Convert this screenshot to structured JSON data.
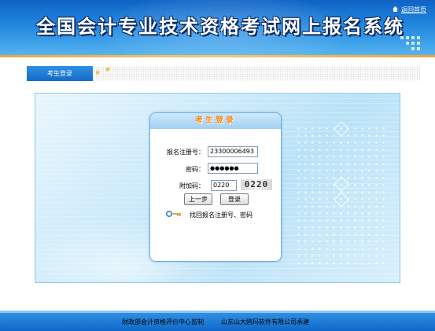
{
  "header": {
    "title": "全国会计专业技术资格考试网上报名系统",
    "home_link": "返回首页"
  },
  "tab": {
    "label": "考生登录"
  },
  "login": {
    "title": "考生登录",
    "reg_label": "报名注册号：",
    "reg_value": "23300006493",
    "pwd_label": "密码：",
    "pwd_value": "●●●●●●",
    "code_label": "附加码：",
    "code_value": "0220",
    "captcha_text": "0220",
    "prev_button": "上一步",
    "login_button": "登录",
    "retrieve_link": "找回报名注册号、密码"
  },
  "footer": {
    "left": "财政部会计资格评价中心监制",
    "right": "山东山大鸥玛软件有限公司承建"
  },
  "colors": {
    "header_blue": "#1f82dc",
    "accent_orange": "#f28a1a",
    "footer_blue": "#1068c8"
  }
}
